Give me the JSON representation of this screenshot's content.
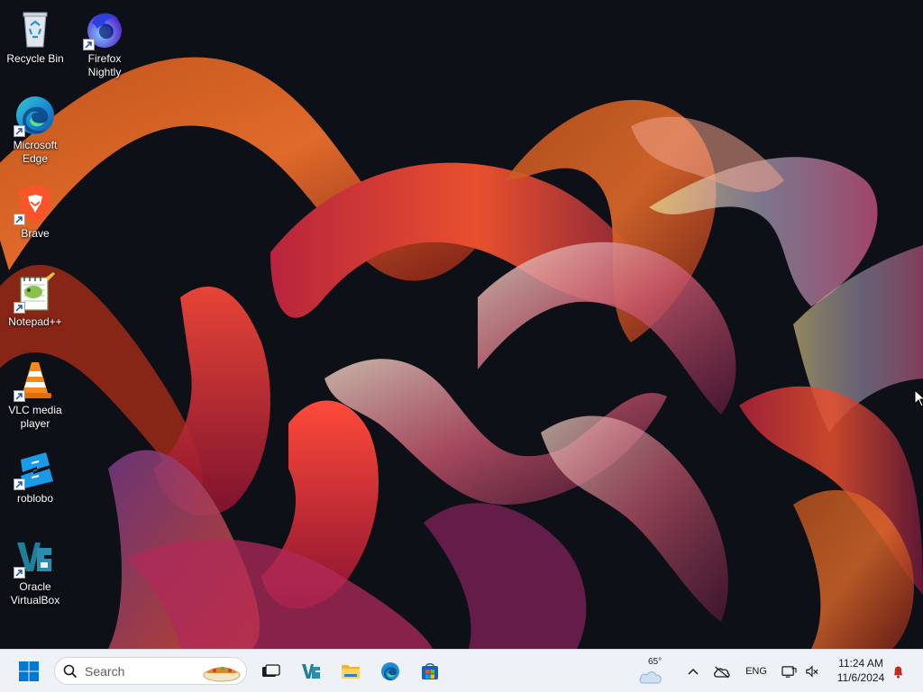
{
  "desktop": {
    "icons": [
      {
        "label": "Recycle Bin",
        "icon": "recycle-bin-icon",
        "shortcut": false
      },
      {
        "label": "Firefox\nNightly",
        "icon": "firefox-nightly-icon",
        "shortcut": true
      },
      {
        "label": "Microsoft\nEdge",
        "icon": "edge-icon",
        "shortcut": true
      },
      {
        "label": "Brave",
        "icon": "brave-icon",
        "shortcut": true
      },
      {
        "label": "Notepad++",
        "icon": "notepad-plus-plus-icon",
        "shortcut": true
      },
      {
        "label": "VLC media\nplayer",
        "icon": "vlc-icon",
        "shortcut": true
      },
      {
        "label": "roblobo",
        "icon": "roblobo-icon",
        "shortcut": true
      },
      {
        "label": "Oracle\nVirtualBox",
        "icon": "virtualbox-icon",
        "shortcut": true
      }
    ]
  },
  "taskbar": {
    "start_icon": "windows-start-icon",
    "search_placeholder": "Search",
    "pinned": [
      {
        "name": "task-view",
        "icon": "task-view-icon"
      },
      {
        "name": "virtualbox",
        "icon": "virtualbox-icon"
      },
      {
        "name": "file-explorer",
        "icon": "folder-icon"
      },
      {
        "name": "edge",
        "icon": "edge-icon"
      },
      {
        "name": "microsoft-store",
        "icon": "store-icon"
      }
    ],
    "tray": {
      "weather_temp": "65°",
      "language": "ENG",
      "time": "11:24 AM",
      "date": "11/6/2024"
    }
  },
  "colors": {
    "taskbar_bg": "#eef1f6",
    "desktop_bg": "#0e1018",
    "notification_bell": "#c42b1c",
    "start_blue": "#0078d4"
  }
}
